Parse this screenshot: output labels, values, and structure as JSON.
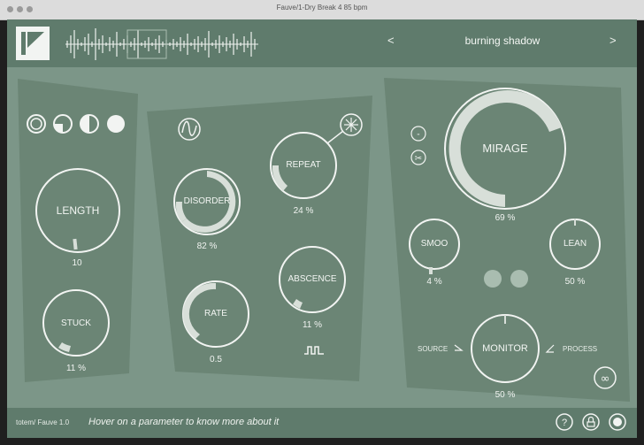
{
  "window": {
    "title": "Fauve/1-Dry Break 4 85 bpm"
  },
  "header": {
    "prev": "<",
    "preset": "burning shadow",
    "next": ">"
  },
  "knobs": {
    "length": {
      "label": "LENGTH",
      "value": "10"
    },
    "stuck": {
      "label": "STUCK",
      "value": "11 %"
    },
    "disorder": {
      "label": "DISORDER",
      "value": "82 %"
    },
    "rate": {
      "label": "RATE",
      "value": "0.5"
    },
    "repeat": {
      "label": "REPEAT",
      "value": "24 %"
    },
    "absence": {
      "label": "ABSCENCE",
      "value": "11 %"
    },
    "mirage": {
      "label": "MIRAGE",
      "value": "69 %"
    },
    "smoo": {
      "label": "SMOO",
      "value": "4 %"
    },
    "lean": {
      "label": "LEAN",
      "value": "50 %"
    },
    "monitor": {
      "label": "MONITOR",
      "value": "50 %"
    }
  },
  "monitor": {
    "source": "SOURCE",
    "process": "PROCESS"
  },
  "footer": {
    "brand": "totem/ Fauve 1.0",
    "hint": "Hover on a parameter to know more about it"
  },
  "colors": {
    "bg": "#7c9688",
    "panel": "#6b8575",
    "header": "#5f7b6c",
    "light": "#f2f4f2",
    "arc": "#d8dfd9"
  },
  "icons": [
    "logo-icon",
    "waveform-icon",
    "quadrant-icons",
    "sine-icon",
    "freeze-icon",
    "square-wave-icon",
    "scissors-icon",
    "help-icon",
    "lock-icon",
    "record-icon",
    "infinity-icon"
  ]
}
